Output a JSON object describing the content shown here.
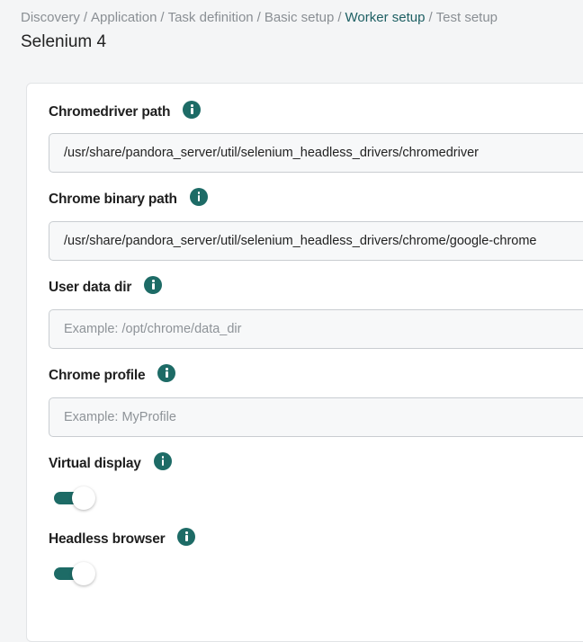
{
  "breadcrumb": [
    {
      "label": "Discovery",
      "active": false
    },
    {
      "label": "Application",
      "active": false
    },
    {
      "label": "Task definition",
      "active": false
    },
    {
      "label": "Basic setup",
      "active": false
    },
    {
      "label": "Worker setup",
      "active": true
    },
    {
      "label": "Test setup",
      "active": false
    }
  ],
  "breadcrumb_separator": "/",
  "page_title": "Selenium 4",
  "form": {
    "chromedriver_path": {
      "label": "Chromedriver path",
      "value": "/usr/share/pandora_server/util/selenium_headless_drivers/chromedriver",
      "placeholder": ""
    },
    "chrome_binary_path": {
      "label": "Chrome binary path",
      "value": "/usr/share/pandora_server/util/selenium_headless_drivers/chrome/google-chrome",
      "placeholder": ""
    },
    "user_data_dir": {
      "label": "User data dir",
      "value": "",
      "placeholder": "Example: /opt/chrome/data_dir"
    },
    "chrome_profile": {
      "label": "Chrome profile",
      "value": "",
      "placeholder": "Example: MyProfile"
    },
    "virtual_display": {
      "label": "Virtual display",
      "enabled": true
    },
    "headless_browser": {
      "label": "Headless browser",
      "enabled": true
    }
  },
  "colors": {
    "accent": "#1d6b66",
    "active_breadcrumb": "#1d5f63"
  },
  "icons": {
    "info": "info-circle-icon"
  }
}
